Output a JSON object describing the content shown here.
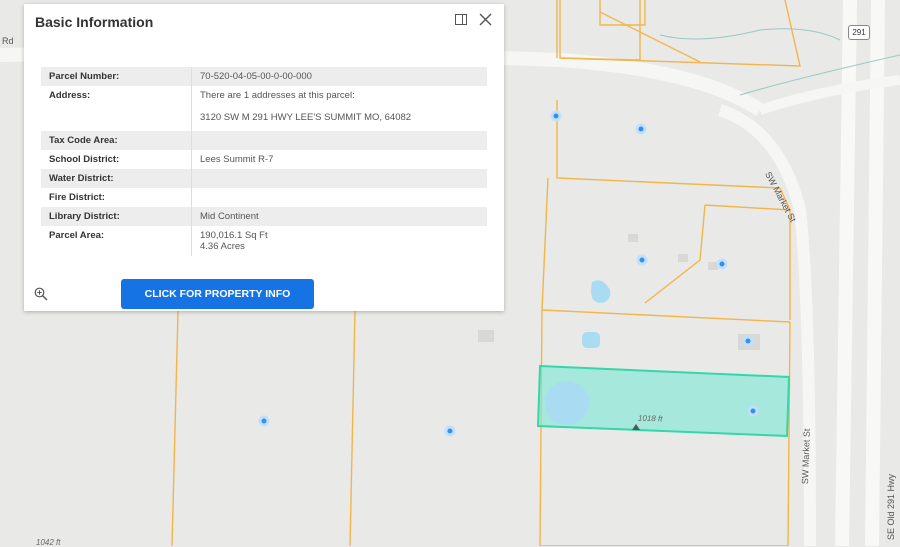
{
  "panel": {
    "title": "Basic Information",
    "cta_label": "CLICK FOR PROPERTY INFO",
    "rows": [
      {
        "label": "Parcel Number:",
        "value": "70-520-04-05-00-0-00-000"
      },
      {
        "label": "Address:",
        "value": "There are 1 addresses at this parcel:",
        "value2": "3120 SW M 291 HWY LEE'S SUMMIT MO, 64082"
      },
      {
        "label": "Tax Code Area:",
        "value": ""
      },
      {
        "label": "School District:",
        "value": "Lees Summit R-7"
      },
      {
        "label": "Water District:",
        "value": ""
      },
      {
        "label": "Fire District:",
        "value": ""
      },
      {
        "label": "Library District:",
        "value": "Mid Continent"
      },
      {
        "label": "Parcel Area:",
        "value": "190,016.1 Sq Ft",
        "value2": "4.36 Acres"
      }
    ]
  },
  "map": {
    "labels": {
      "road_rd": "Rd",
      "sw_market_upper": "SW Market St",
      "sw_market_lower": "SW Market St",
      "se_old_291": "SE Old 291 Hwy",
      "highway_shield": "291",
      "dim_1018": "1018 ft",
      "dim_1042": "1042 ft"
    },
    "colors": {
      "parcel_line": "#f2b54a",
      "selected_fill": "#7ae8d6",
      "selected_stroke": "#35d6a8",
      "water": "#a9dcf2",
      "marker": "#3b8fe0",
      "button": "#1673e4"
    }
  }
}
